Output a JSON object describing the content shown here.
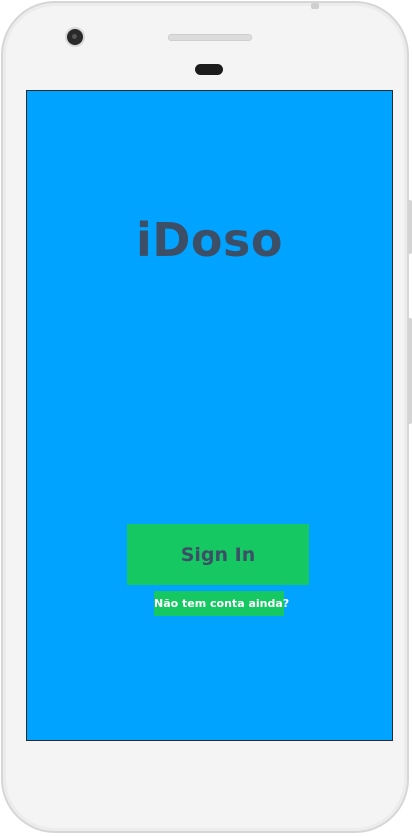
{
  "app": {
    "title": "iDoso"
  },
  "login": {
    "signin_label": "Sign In",
    "signup_link": "Não tem conta ainda?"
  },
  "colors": {
    "background": "#00a3ff",
    "button": "#16c862",
    "title_text": "#3d4f66",
    "link_text": "#ffffff"
  }
}
